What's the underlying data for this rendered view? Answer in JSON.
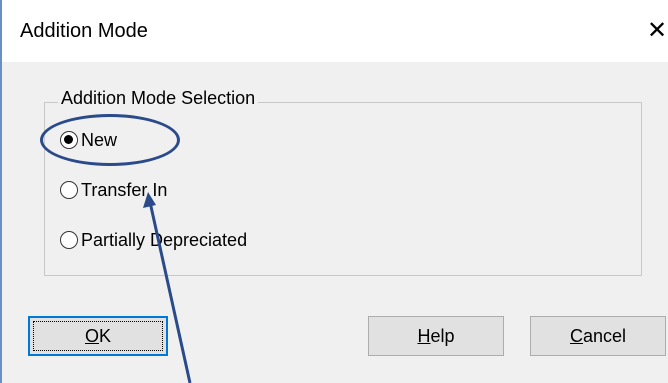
{
  "dialog": {
    "title": "Addition Mode",
    "close_glyph": "✕"
  },
  "group": {
    "legend": "Addition Mode Selection",
    "options": [
      {
        "label": "New",
        "checked": true
      },
      {
        "label": "Transfer In",
        "checked": false
      },
      {
        "label": "Partially Depreciated",
        "checked": false
      }
    ]
  },
  "buttons": {
    "ok": "OK",
    "help": "Help",
    "cancel": "Cancel"
  },
  "annotation": {
    "highlight_color": "#2a4a8a",
    "highlighted_option": "New"
  }
}
